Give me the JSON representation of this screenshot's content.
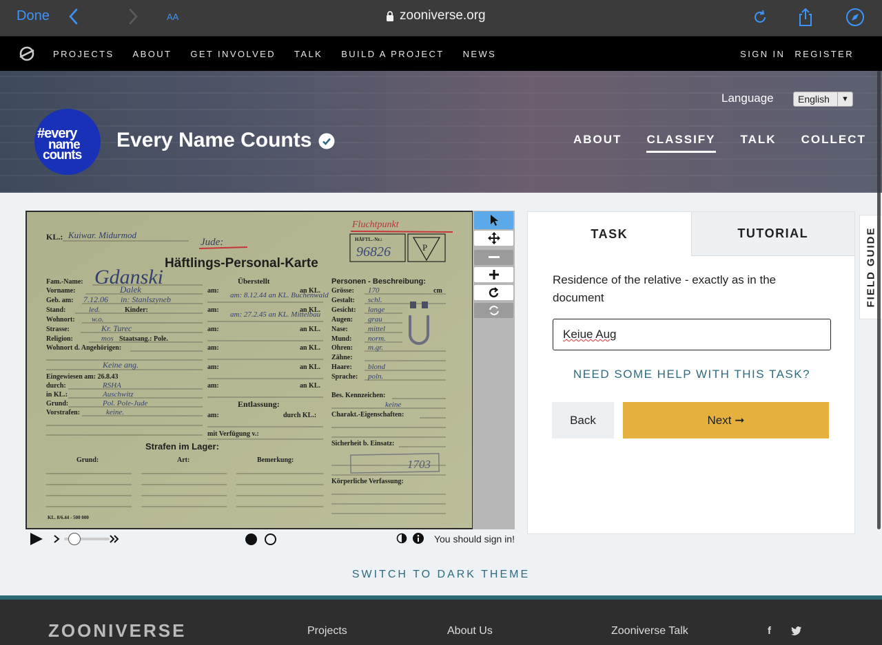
{
  "browser": {
    "done_label": "Done",
    "text_size_label": "AA",
    "url": "zooniverse.org"
  },
  "zoo_nav": {
    "links": [
      "PROJECTS",
      "ABOUT",
      "GET INVOLVED",
      "TALK",
      "BUILD A PROJECT",
      "NEWS"
    ],
    "sign_in": "SIGN IN",
    "register": "REGISTER"
  },
  "project": {
    "language_label": "Language",
    "language_value": "English",
    "avatar_text": [
      "#every",
      "name",
      "counts"
    ],
    "title": "Every Name Counts",
    "tabs": [
      "ABOUT",
      "CLASSIFY",
      "TALK",
      "COLLECT"
    ],
    "active_tab": "CLASSIFY"
  },
  "card": {
    "kl": "KL.:",
    "kl_hand": "Kuiwar. Midurmod",
    "jude": "Jude:",
    "fluchtpunkt": "Fluchtpunkt",
    "haftl_label": "HÄFTL.-Nr.:",
    "haftl_number": "96826",
    "triangle_letter": "P",
    "title": "Häftlings-Personal-Karte",
    "left_labels": [
      "Fam.-Name:",
      "Vorname:",
      "Geb. am:",
      "Stand:",
      "Wohnort:",
      "Strasse:",
      "Religion:",
      "Wohnort d. Angehörigen:"
    ],
    "left_values": [
      "Gdanski",
      "Dalek",
      "7.12.06",
      "led.",
      "w.o.",
      "Kr. Turec",
      "mos",
      "Staatsang.: Pole."
    ],
    "geb_in": "in: Stanlszyneb",
    "kinder": "Kinder:",
    "relative_residence": "Keine ang.",
    "eingewiesen": [
      "Eingewiesen am: 26.8.43",
      "durch:",
      "in KL.:",
      "Grund:",
      "Vorstrafen:"
    ],
    "eingewiesen_values": [
      "RSHA",
      "Auschwitz",
      "Pol. Pole-Jude",
      "keine."
    ],
    "uberstellt": "Überstellt",
    "uberstellt_rows": [
      "am: 8.12.44 an KL. Buchenwald",
      "am: 27.2.45 an KL. Mittelbau"
    ],
    "am": "am:",
    "an_kl": "an KL.",
    "entlassung": "Entlassung:",
    "durch_kl": "durch KL.:",
    "mit_verfugung": "mit Verfügung v.:",
    "strafen": "Strafen im Lager:",
    "strafen_cols": [
      "Grund:",
      "Art:",
      "Bemerkung:"
    ],
    "personen": "Personen - Beschreibung:",
    "personen_labels": [
      "Grösse:",
      "Gestalt:",
      "Gesicht:",
      "Augen:",
      "Nase:",
      "Mund:",
      "Ohren:",
      "Zähne:",
      "Haare:",
      "Sprache:"
    ],
    "personen_values": [
      "170",
      "schl.",
      "lange",
      "grau",
      "mittel",
      "norm.",
      "m.gr.",
      "",
      "blond",
      "poln."
    ],
    "cm": "cm",
    "bes_kennzeichen": "Bes. Kennzeichen:",
    "bes_value": "keine",
    "charakt": "Charakt.-Eigenschaften:",
    "sicherheit": "Sicherheit b. Einsatz:",
    "stamp": "1703",
    "korperliche": "Körperliche Verfassung:",
    "footer_print": "KL. 8/6.44 - 500 000"
  },
  "viewer": {
    "sign_in_notice": "You should sign in!"
  },
  "task": {
    "tab_task": "TASK",
    "tab_tutorial": "TUTORIAL",
    "question": "Residence of the relative - exactly as in the document",
    "answer_value": "Keiue Aug",
    "help_link": "NEED SOME HELP WITH THIS TASK?",
    "back_label": "Back",
    "next_label": "Next ➞"
  },
  "field_guide_label": "FIELD GUIDE",
  "dark_theme_label": "SWITCH TO DARK THEME",
  "footer": {
    "logo": "ZOONIVERSE",
    "links": [
      "Projects",
      "About Us",
      "Zooniverse Talk"
    ]
  },
  "colors": {
    "accent_blue": "#3d94f6",
    "brand_teal": "#2e6a80",
    "next_button": "#e5b03d",
    "avatar_blue": "#1931b7"
  }
}
